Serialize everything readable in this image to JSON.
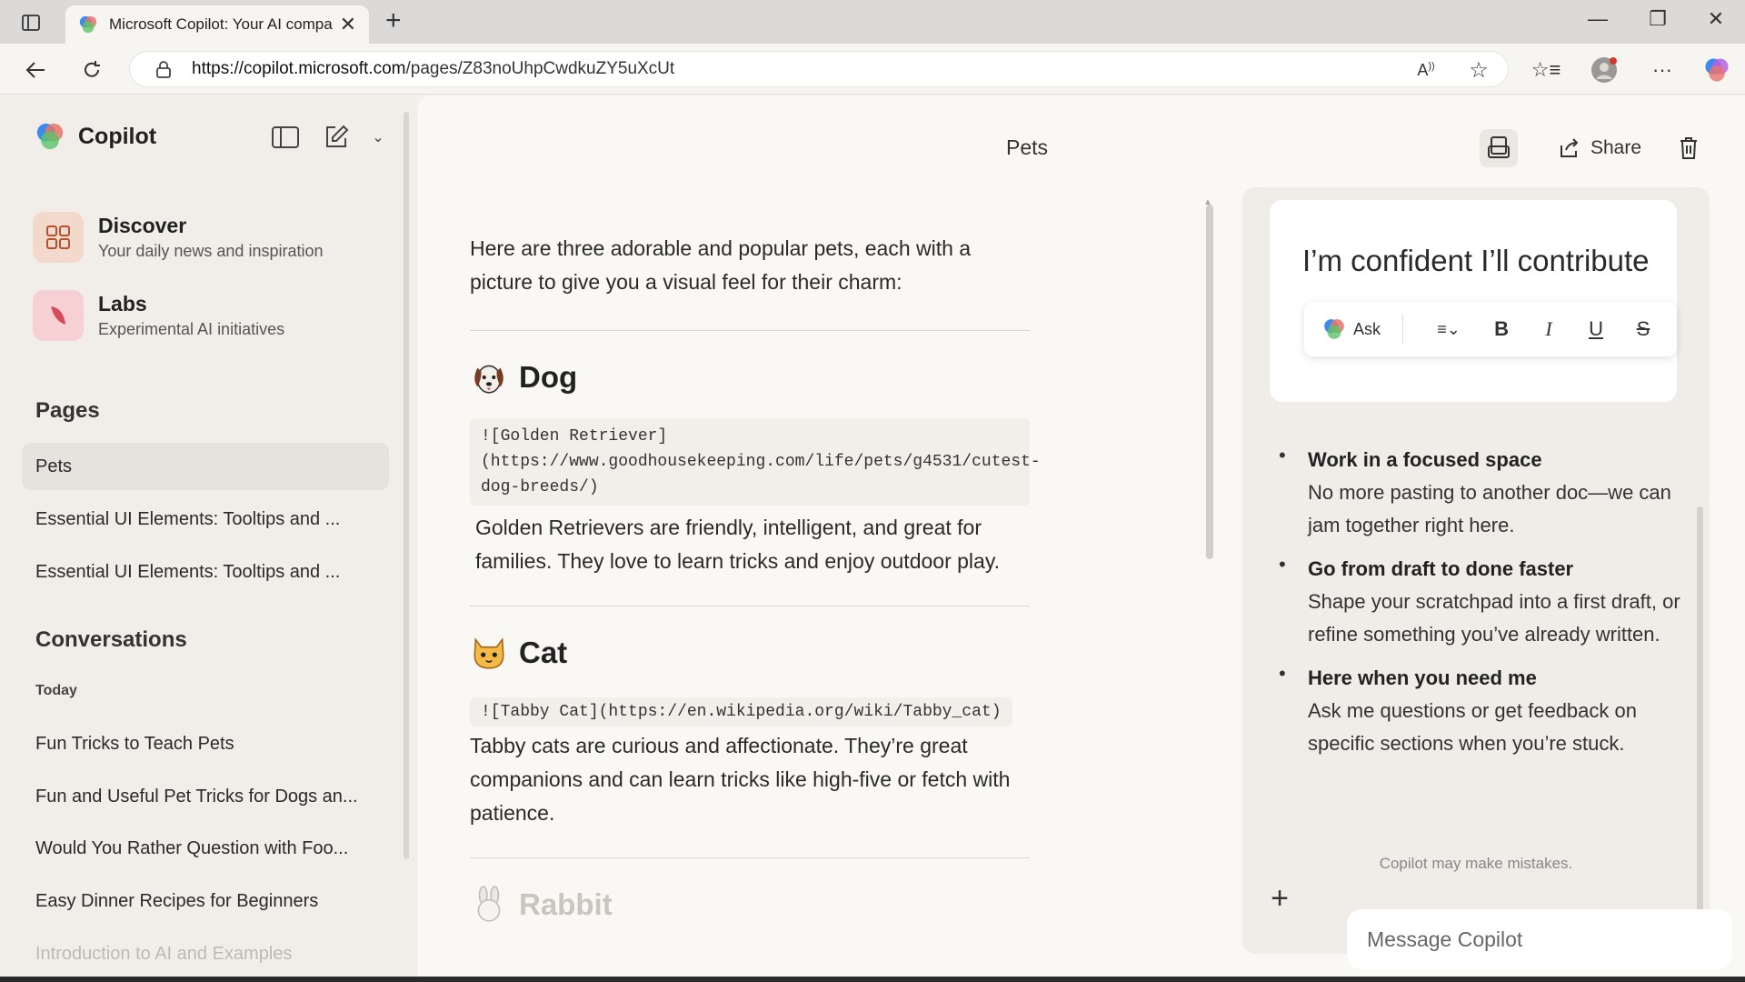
{
  "browser": {
    "tab_title": "Microsoft Copilot: Your AI compa",
    "new_tab_label": "+",
    "close_label": "✕",
    "url_host": "https://copilot.microsoft.com",
    "url_path": "/pages/Z83noUhpCwdkuZY5uXcUt"
  },
  "sidebar": {
    "brand": "Copilot",
    "features": [
      {
        "title": "Discover",
        "subtitle": "Your daily news and inspiration"
      },
      {
        "title": "Labs",
        "subtitle": "Experimental AI initiatives"
      }
    ],
    "pages_heading": "Pages",
    "pages": [
      "Pets",
      "Essential UI Elements: Tooltips and ...",
      "Essential UI Elements: Tooltips and ..."
    ],
    "conversations_heading": "Conversations",
    "today_label": "Today",
    "conversations": [
      "Fun Tricks to Teach Pets",
      "Fun and Useful Pet Tricks for Dogs an...",
      "Would You Rather Question with Foo...",
      "Easy Dinner Recipes for Beginners",
      "Introduction to AI and Examples"
    ]
  },
  "main": {
    "page_title": "Pets",
    "share_label": "Share",
    "intro": "Here are three adorable and popular pets, each with a picture to give you a visual feel for their charm:",
    "pets": [
      {
        "name": "Dog",
        "code": "![Golden Retriever](https://www.goodhousekeeping.com/life/pets/g4531/cutest-dog-breeds/)",
        "text": "Golden Retrievers are friendly, intelligent, and great for families. They love to learn tricks and enjoy outdoor play."
      },
      {
        "name": "Cat",
        "code": "![Tabby Cat](https://en.wikipedia.org/wiki/Tabby_cat)",
        "text": "Tabby cats are curious and affectionate. They’re great companions and can learn tricks like high-five or fetch with patience."
      },
      {
        "name": "Rabbit"
      }
    ]
  },
  "panel": {
    "card_text": "I’m confident I’ll contribute",
    "ask_label": "Ask",
    "bold_label": "B",
    "italic_label": "I",
    "underline_label": "U",
    "strike_label": "S",
    "bullets": [
      {
        "title": "Work in a focused space",
        "desc": "No more pasting to another doc—we can jam together right here."
      },
      {
        "title": "Go from draft to done faster",
        "desc": "Shape your scratchpad into a first draft, or refine something you’ve already written."
      },
      {
        "title": "Here when you need me",
        "desc": "Ask me questions or get feedback on specific sections when you’re stuck."
      }
    ],
    "disclaimer": "Copilot may make mistakes.",
    "composer_placeholder": "Message Copilot"
  },
  "colors": {
    "accent": "#e8746b",
    "sidebar_bg": "#f1eeea",
    "main_bg": "#faf8f5"
  }
}
